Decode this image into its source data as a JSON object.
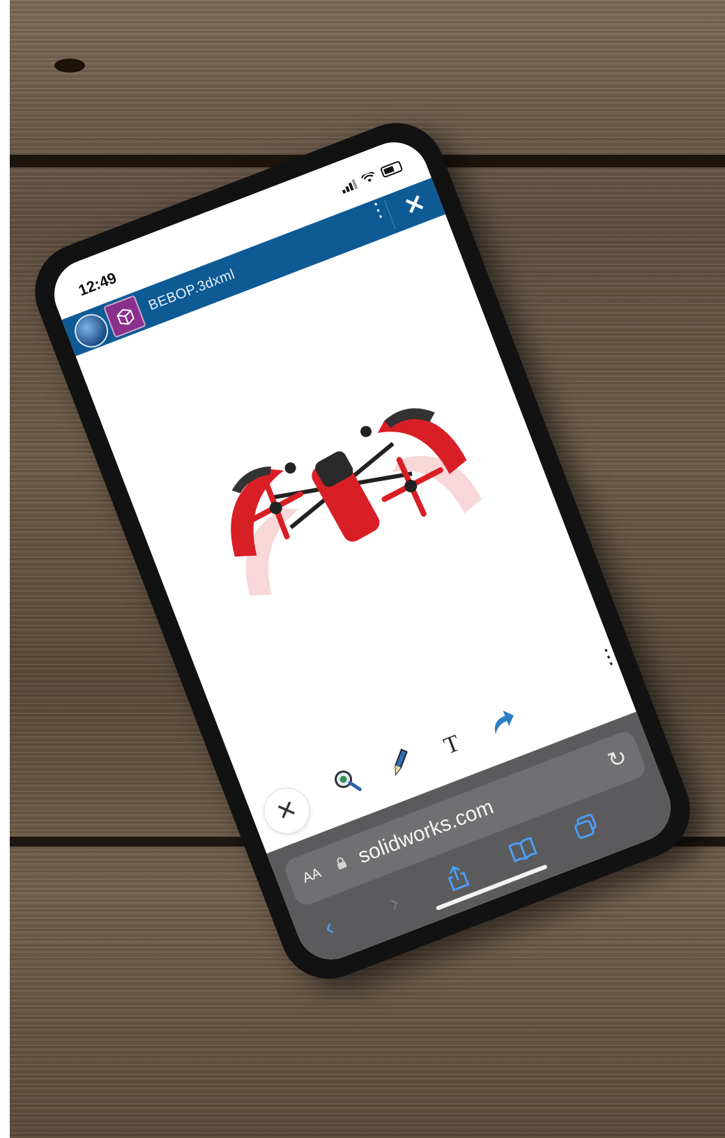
{
  "status_bar": {
    "time": "12:49"
  },
  "app_header": {
    "file_name": "BEBOP.3dxml",
    "menu_glyph": "⋮",
    "close_glyph": "✕"
  },
  "markup_toolbar": {
    "close_glyph": "✕",
    "text_tool_glyph": "T",
    "more_glyph": "⋮",
    "icons": [
      "zoom-icon",
      "pencil-icon",
      "text-tool-icon",
      "share-arrow-icon",
      "more-vert-icon"
    ]
  },
  "safari": {
    "text_size_label": "AA",
    "url": "solidworks.com",
    "reload_glyph": "↻",
    "back_glyph": "‹",
    "forward_glyph": "›"
  },
  "colors": {
    "app_header_bg": "#0e5a95",
    "app_tile_bg": "#8b2f8d",
    "drone_red": "#d91f26",
    "safari_blue": "#4d9df7"
  }
}
